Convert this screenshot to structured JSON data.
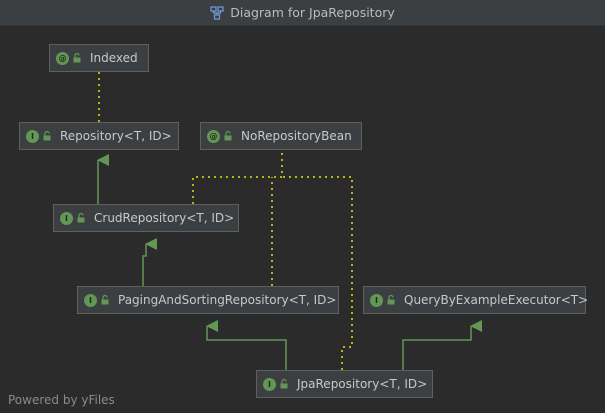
{
  "window": {
    "title": "Diagram for JpaRepository",
    "title_icon": "diagram-icon"
  },
  "nodes": {
    "indexed": {
      "label": "Indexed",
      "kind": "annotation",
      "badge": "@"
    },
    "repository": {
      "label": "Repository<T, ID>",
      "kind": "interface",
      "badge": "I"
    },
    "norepobean": {
      "label": "NoRepositoryBean",
      "kind": "annotation",
      "badge": "@"
    },
    "crudrepo": {
      "label": "CrudRepository<T, ID>",
      "kind": "interface",
      "badge": "I"
    },
    "pagingrepo": {
      "label": "PagingAndSortingRepository<T, ID>",
      "kind": "interface",
      "badge": "I"
    },
    "qbeexecutor": {
      "label": "QueryByExampleExecutor<T>",
      "kind": "interface",
      "badge": "I"
    },
    "jparepo": {
      "label": "JpaRepository<T, ID>",
      "kind": "interface",
      "badge": "I"
    }
  },
  "colors": {
    "background": "#2b2b2b",
    "node_fill": "#3c3f41",
    "node_border": "#5e6060",
    "inheritance_edge": "#629755",
    "annotation_edge": "#b5b51a",
    "badge": "#629755"
  },
  "footer": {
    "text": "Powered by yFiles"
  }
}
